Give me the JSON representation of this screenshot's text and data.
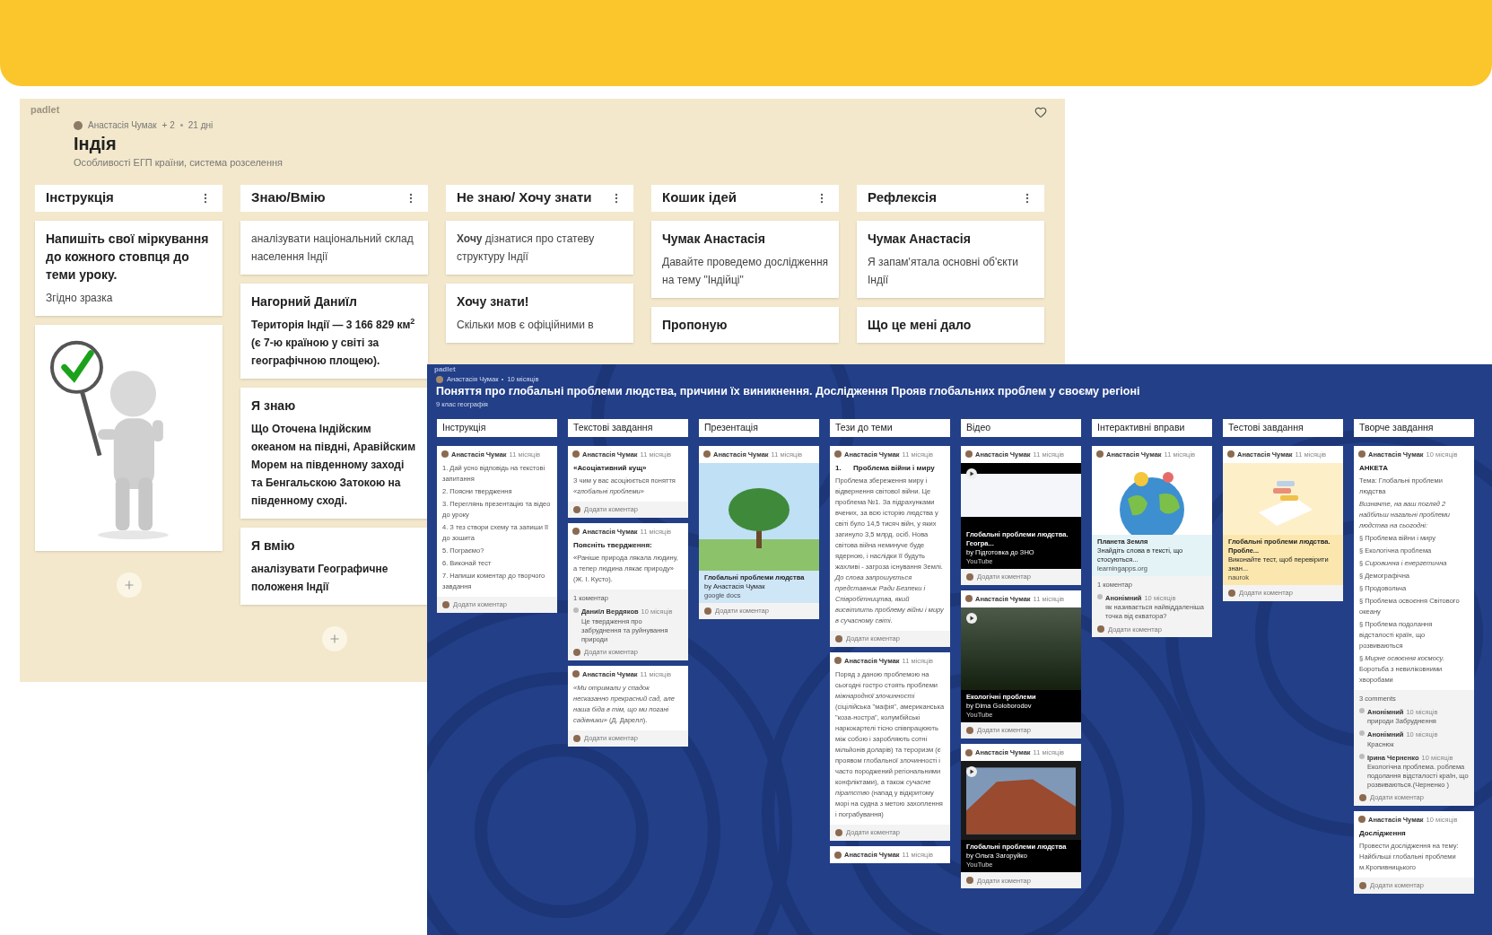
{
  "board_1": {
    "logo": "padlet",
    "author": "Анастасія Чумак",
    "collaborators": "+ 2",
    "time": "21 дні",
    "title": "Індія",
    "subtitle": "Особливості ЕГП країни, система розселення",
    "columns": [
      {
        "title": "Інструкція",
        "add_button": true,
        "cards": [
          {
            "kind": "note",
            "title": "Напишіть свої міркування до кожного стовпця до теми уроку.",
            "body": "Згідно зразка",
            "body_bold": false
          },
          {
            "kind": "image"
          }
        ]
      },
      {
        "title": "Знаю/Вмію",
        "add_button": true,
        "cards": [
          {
            "kind": "note",
            "body": "аналізувати національний склад населення Індії",
            "body_bold": false
          },
          {
            "kind": "note",
            "title": "Нагорний Даниїл",
            "body": "Територія Індії — 3 166 829 км$^{2}$ (є 7-ю країною у світі за географічною площею).",
            "body_bold": true
          },
          {
            "kind": "note",
            "title": "Я знаю",
            "body": "Що Оточена Індійским океаном на півдні, Аравійским  Морем на південному заході та Бенгальскою  Затокою на південному сході.",
            "body_bold": true
          },
          {
            "kind": "note",
            "title": "Я вмію",
            "body": "аналізувати Географичне положеня Індії",
            "body_bold": true
          }
        ]
      },
      {
        "title": "Не знаю/ Хочу знати",
        "cards": [
          {
            "kind": "note",
            "body": "**Хочу** дізнатися про статеву структуру Індії",
            "body_bold": false
          },
          {
            "kind": "note",
            "title": "Хочу знати!",
            "body": "Скільки мов є офіційними в",
            "body_bold": false
          }
        ]
      },
      {
        "title": "Кошик ідей",
        "cards": [
          {
            "kind": "note",
            "title": "Чумак Анастасія",
            "body": "Давайте проведемо дослідження на тему \"Індійці\"",
            "body_bold": false
          },
          {
            "kind": "note",
            "title": "Пропоную"
          }
        ]
      },
      {
        "title": "Рефлексія",
        "cards": [
          {
            "kind": "note",
            "title": "Чумак Анастасія",
            "body": "Я запам'ятала основні об'єкти Індії",
            "body_bold": false
          },
          {
            "kind": "note",
            "title": "Що це мені дало"
          }
        ]
      }
    ]
  },
  "board_2": {
    "logo": "padlet",
    "author": "Анастасія Чумак",
    "time": "10 місяців",
    "title": "Поняття про глобальні проблеми людства, причини їх виникнення. Дослідження Прояв глобальних проблем у своєму регіоні",
    "subtitle": "9 клас географія",
    "columns": [
      {
        "title": "Інструкція",
        "cards": [
          {
            "author": "Анастасія Чумак",
            "time": "11 місяців",
            "body": [
              "1. Дай усно відповідь на текстові запитання",
              "2. Поясни твердження",
              "3. Переглянь презентацію та відео до уроку",
              "4. З тез створи схему та запиши її до зошита",
              "5. Пограємо?",
              "6. Виконай тест",
              "7. Напиши коментар до творчого завдання"
            ],
            "add_comment": "Додати коментар"
          }
        ]
      },
      {
        "title": "Текстові завдання",
        "cards": [
          {
            "author": "Анастасія Чумак",
            "time": "11 місяців",
            "title": "«Асоціативний кущ»",
            "body": [
              "З чим у вас асоціюється поняття *«глобальні проблеми»*"
            ],
            "add_comment": "Додати коментар"
          },
          {
            "author": "Анастасія Чумак",
            "time": "11 місяців",
            "title": "Поясніть твердження:",
            "body": [
              "«Раніше природа лякала людину, а тепер людина лякає природу» (Ж. І. Кусто)."
            ],
            "comments_count": "1 коментар",
            "comments": [
              {
                "author": "Даниїл Вердяков",
                "time": "10 місяців",
                "text": "Це твердження про забруднення та руйнування природи"
              }
            ],
            "add_comment": "Додати коментар"
          },
          {
            "author": "Анастасія Чумак",
            "time": "11 місяців",
            "body": [
              "*«Ми отримали у спадок несказанно прекрасний сад, але наша біда в тім, що ми погані садівники»* (Д. Дарелл)."
            ],
            "add_comment": "Додати коментар"
          }
        ]
      },
      {
        "title": "Презентація",
        "cards": [
          {
            "author": "Анастасія Чумак",
            "time": "11 місяців",
            "media": {
              "kind": "tree"
            },
            "link": {
              "title": "Глобальні проблеми людства",
              "byline": "by Анастасія Чумак",
              "source": "google docs"
            },
            "add_comment": "Додати коментар"
          }
        ]
      },
      {
        "title": "Тези до теми",
        "cards": [
          {
            "author": "Анастасія Чумак",
            "time": "11 місяців",
            "title": "1.      Проблема війни і миру",
            "body": [
              "Проблема збереження миру і відвернення світової війни. Це проблема №1. За підрахунками вчених, за всю історію людства у світі було 14,5 тисяч війн, у яких загинуло 3,5 млрд. осіб. Нова світова війна неминуче буде ядерною, і наслідки її будуть жахливі - загроза існування Землі. *До слова запрошується представник Ради Безпеки і Співробітництва, який висвітлить проблему війни і миру в сучасному світі.*"
            ],
            "add_comment": "Додати коментар"
          },
          {
            "author": "Анастасія Чумак",
            "time": "11 місяців",
            "body": [
              "Поряд з даною проблемою на сьогодні гостро стоять проблеми *міжнародної злочинності* (сіцілійська \"мафія\", американська \"коза-ностра\", колумбійські наркокартелі тісно співпрацюють між собою і заробляють сотні мільйонів доларів) та тероризм (є проявом глобальної злочинності і часто породжений регіональними конфліктами), а також *сучасне піратство* (напад у відкритому морі на судна з метою захоплення і пограбування)"
            ],
            "add_comment": "Додати коментар"
          },
          {
            "author": "Анастасія Чумак",
            "time": "11 місяців"
          }
        ]
      },
      {
        "title": "Відео",
        "cards": [
          {
            "author": "Анастасія Чумак",
            "time": "11 місяців",
            "media": {
              "kind": "video"
            },
            "link": {
              "title": "Глобальні проблеми людства. Геогра...",
              "byline": "by Підготовка до ЗНО",
              "source": "YouTube"
            },
            "add_comment": "Додати коментар"
          },
          {
            "author": "Анастасія Чумак",
            "time": "11 місяців",
            "media": {
              "kind": "forest"
            },
            "link": {
              "title": "Екологічні проблеми",
              "byline": "by Dima Goloborodov",
              "source": "YouTube"
            },
            "add_comment": "Додати коментар"
          },
          {
            "author": "Анастасія Чумак",
            "time": "11 місяців",
            "media": {
              "kind": "mountain"
            },
            "link": {
              "title": "Глобальні проблеми людства",
              "byline": "by Ольга Загоруйко",
              "source": "YouTube"
            },
            "add_comment": "Додати коментар"
          }
        ]
      },
      {
        "title": "Інтерактивні вправи",
        "cards": [
          {
            "author": "Анастасія Чумак",
            "time": "11 місяців",
            "media": {
              "kind": "globe"
            },
            "link": {
              "title": "Планета Земля",
              "byline": "Знайдіть слова в тексті, що стосуються...",
              "source": "learningapps.org"
            },
            "comments_count": "1 коментар",
            "comments": [
              {
                "author": "Анонімний",
                "time": "10 місяців",
                "text": "як називається найвіддаленіша точка від екватора?"
              }
            ],
            "add_comment": "Додати коментар"
          }
        ]
      },
      {
        "title": "Тестові завдання",
        "cards": [
          {
            "author": "Анастасія Чумак",
            "time": "11 місяців",
            "media": {
              "kind": "quiz"
            },
            "link": {
              "title": "Глобальні проблеми людства. Пробле...",
              "byline": "Виконайте тест, щоб перевірити знан...",
              "source": "naurok"
            },
            "add_comment": "Додати коментар"
          }
        ]
      },
      {
        "title": "Творче завдання",
        "cards": [
          {
            "author": "Анастасія Чумак",
            "time": "10 місяців",
            "title": "АНКЕТА",
            "body": [
              "Тема: Глобальні проблеми людства",
              "*Визначте, на ваш погляд 2 найбільш нагальні проблеми людства на сьогодні:*",
              "§  Проблема війни і миру",
              "§  Екологічна проблема",
              "§  *Сировинна і енергетична*",
              "§  Демографічна",
              "§  Продовольча",
              "§  Проблема освоєння Світового океану",
              "§  Проблема подолання відсталості країн, що розвиваються",
              "§  *Мирне освоєння космосу.* Боротьба з невиліковними хворобами"
            ],
            "comments_count": "3 comments",
            "comments": [
              {
                "author": "Анонімний",
                "time": "10 місяців",
                "text": "природи Забруднення"
              },
              {
                "author": "Анонімний",
                "time": "10 місяців",
                "text": "Краснюк"
              },
              {
                "author": "Ірина Черненко",
                "time": "10 місяців",
                "text": "Екологічна проблема. роблема подолання відсталості країн, що розвиваються.(Черненко )"
              }
            ],
            "add_comment": "Додати коментар"
          },
          {
            "author": "Анастасія Чумак",
            "time": "10 місяців",
            "title": "Дослідження",
            "body": [
              "Провести дослідження на тему: Найбільші глобальні проблеми м.Кропивницького"
            ],
            "add_comment": "Додати коментар"
          }
        ]
      }
    ]
  }
}
